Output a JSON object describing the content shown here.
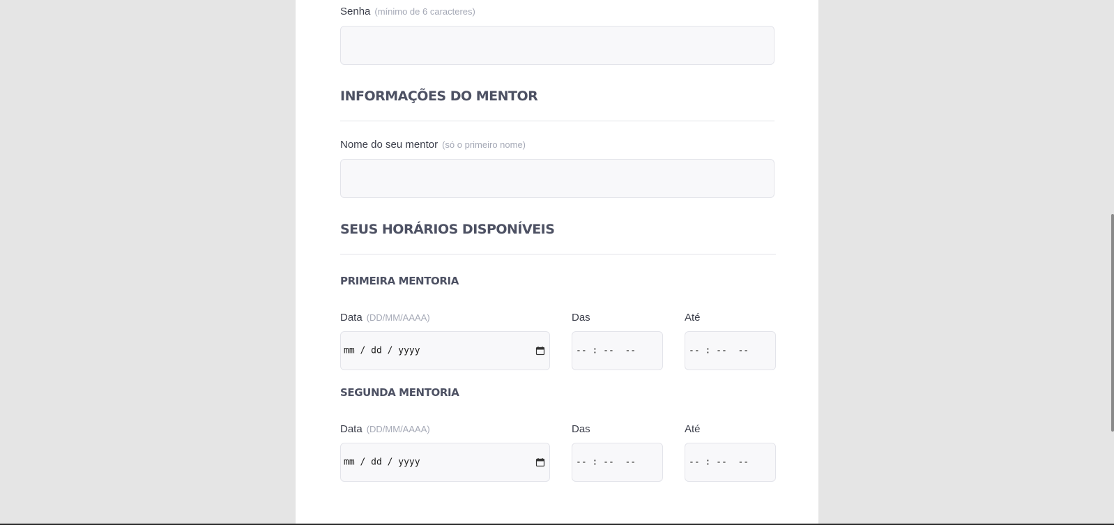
{
  "password": {
    "label": "Senha",
    "hint": "(mínimo de 6 caracteres)",
    "value": ""
  },
  "mentor_section": {
    "title": "INFORMAÇÕES DO MENTOR",
    "name_label": "Nome do seu mentor",
    "name_hint": "(só o primeiro nome)",
    "name_value": ""
  },
  "schedule_section": {
    "title": "SEUS HORÁRIOS DISPONÍVEIS",
    "sessions": [
      {
        "title": "PRIMEIRA MENTORIA",
        "date_label": "Data",
        "date_hint": "(DD/MM/AAAA)",
        "date_value": "mm / dd / yyyy",
        "from_label": "Das",
        "from_value": "-- : --  --",
        "to_label": "Até",
        "to_value": "-- : --  --"
      },
      {
        "title": "SEGUNDA MENTORIA",
        "date_label": "Data",
        "date_hint": "(DD/MM/AAAA)",
        "date_value": "mm / dd / yyyy",
        "from_label": "Das",
        "from_value": "-- : --  --",
        "to_label": "Até",
        "to_value": "-- : --  --"
      }
    ]
  },
  "icons": {
    "date_picker": "calendar-icon"
  },
  "colors": {
    "page_background": "#e5e5e5",
    "card_background": "#ffffff",
    "heading": "#4d5163",
    "label": "#3b3e4a",
    "hint": "#a5a9b6",
    "input_background": "#f8f8fa",
    "input_border": "#e3e4ea"
  }
}
